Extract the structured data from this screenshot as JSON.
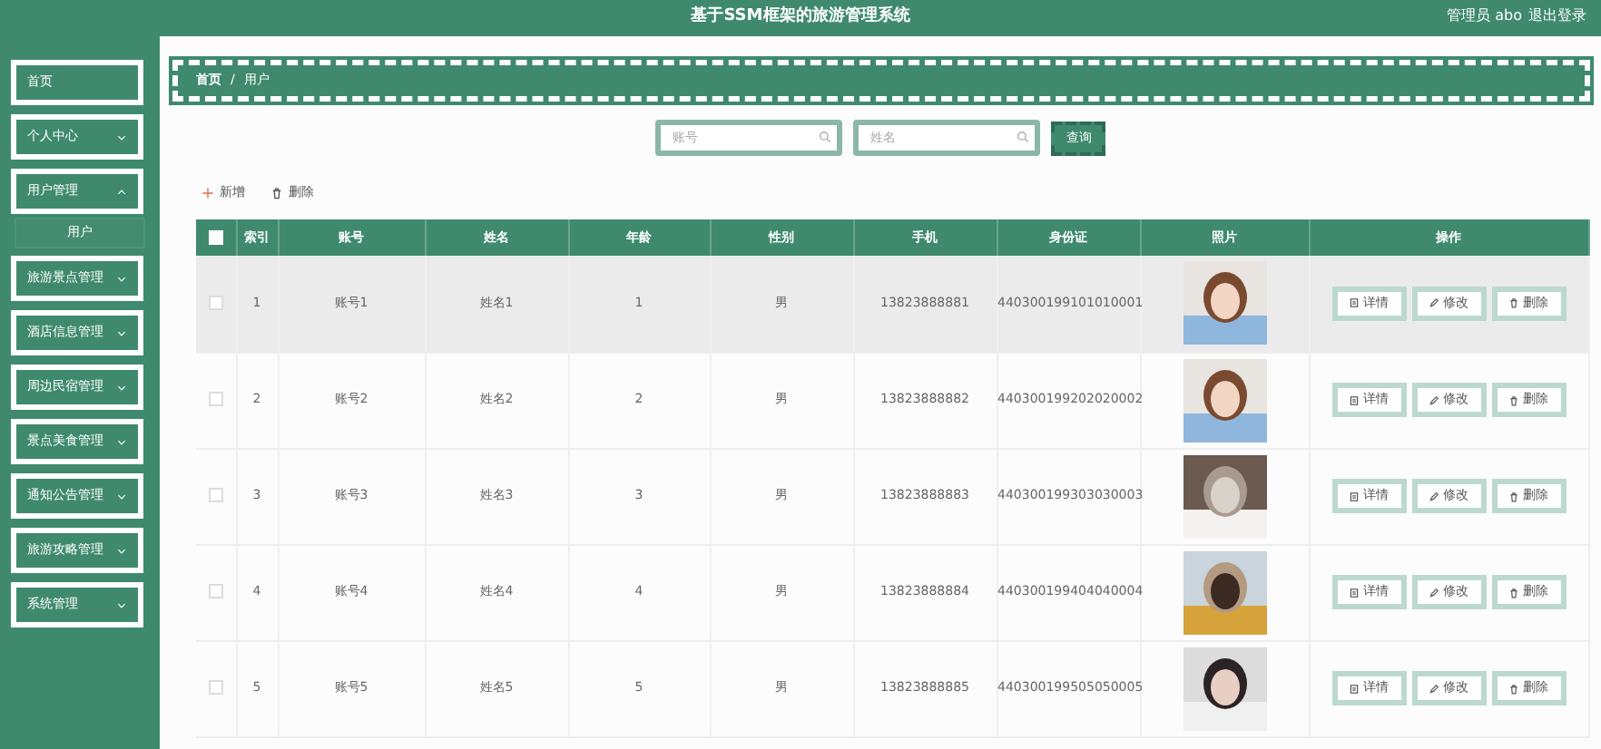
{
  "header": {
    "title": "基于SSM框架的旅游管理系统",
    "user": "管理员 abo",
    "logout": "退出登录"
  },
  "sidebar": {
    "items": [
      {
        "label": "首页",
        "kind": "link"
      },
      {
        "label": "个人中心",
        "kind": "group",
        "expanded": false
      },
      {
        "label": "用户管理",
        "kind": "group",
        "expanded": true,
        "children": [
          {
            "label": "用户",
            "selected": true
          }
        ]
      },
      {
        "label": "旅游景点管理",
        "kind": "group",
        "expanded": false
      },
      {
        "label": "酒店信息管理",
        "kind": "group",
        "expanded": false
      },
      {
        "label": "周边民宿管理",
        "kind": "group",
        "expanded": false
      },
      {
        "label": "景点美食管理",
        "kind": "group",
        "expanded": false
      },
      {
        "label": "通知公告管理",
        "kind": "group",
        "expanded": false
      },
      {
        "label": "旅游攻略管理",
        "kind": "group",
        "expanded": false
      },
      {
        "label": "系统管理",
        "kind": "group",
        "expanded": false
      }
    ]
  },
  "breadcrumb": {
    "items": [
      "首页",
      "用户"
    ],
    "separator": "/"
  },
  "search": {
    "fields": [
      {
        "placeholder": "账号"
      },
      {
        "placeholder": "姓名"
      }
    ],
    "button": "查询"
  },
  "toolbar": {
    "add": "新增",
    "delete": "删除"
  },
  "table": {
    "select_all": {
      "checked": false
    },
    "columns": [
      "索引",
      "账号",
      "姓名",
      "年龄",
      "性别",
      "手机",
      "身份证",
      "照片",
      "操作"
    ],
    "rows": [
      {
        "index": "1",
        "account": "账号1",
        "name": "姓名1",
        "age": "1",
        "gender": "男",
        "phone": "13823888881",
        "id_card": "440300199101010001",
        "checked": false,
        "highlighted": true,
        "actions": [
          "详情",
          "修改",
          "删除"
        ]
      },
      {
        "index": "2",
        "account": "账号2",
        "name": "姓名2",
        "age": "2",
        "gender": "男",
        "phone": "13823888882",
        "id_card": "440300199202020002",
        "checked": false,
        "highlighted": false,
        "actions": [
          "详情",
          "修改",
          "删除"
        ]
      },
      {
        "index": "3",
        "account": "账号3",
        "name": "姓名3",
        "age": "3",
        "gender": "男",
        "phone": "13823888883",
        "id_card": "440300199303030003",
        "checked": false,
        "highlighted": false,
        "actions": [
          "详情",
          "修改",
          "删除"
        ]
      },
      {
        "index": "4",
        "account": "账号4",
        "name": "姓名4",
        "age": "4",
        "gender": "男",
        "phone": "13823888884",
        "id_card": "440300199404040004",
        "checked": false,
        "highlighted": false,
        "actions": [
          "详情",
          "修改",
          "删除"
        ]
      },
      {
        "index": "5",
        "account": "账号5",
        "name": "姓名5",
        "age": "5",
        "gender": "男",
        "phone": "13823888885",
        "id_card": "440300199505050005",
        "checked": false,
        "highlighted": false,
        "actions": [
          "详情",
          "修改",
          "删除"
        ]
      }
    ]
  }
}
